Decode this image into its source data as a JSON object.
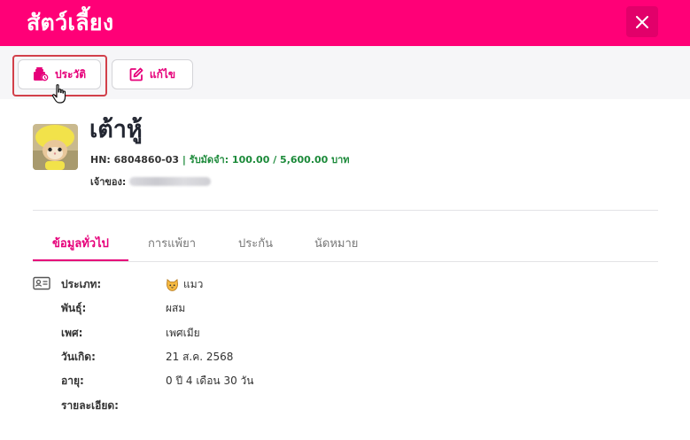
{
  "header": {
    "title": "สัตว์เลี้ยง"
  },
  "toolbar": {
    "history_label": "ประวัติ",
    "edit_label": "แก้ไข"
  },
  "pet": {
    "name": "เต้าหู้",
    "hn": "HN: 6804860-03",
    "separator": " | ",
    "deposit": "รับมัดจำ: 100.00 / 5,600.00 บาท",
    "owner_label": "เจ้าของ:"
  },
  "tabs": [
    {
      "label": "ข้อมูลทั่วไป",
      "active": true
    },
    {
      "label": "การแพ้ยา",
      "active": false
    },
    {
      "label": "ประกัน",
      "active": false
    },
    {
      "label": "นัดหมาย",
      "active": false
    }
  ],
  "info": {
    "type_label": "ประเภท:",
    "type_value": "แมว",
    "breed_label": "พันธุ์:",
    "breed_value": "ผสม",
    "sex_label": "เพศ:",
    "sex_value": "เพศเมีย",
    "birth_label": "วันเกิด:",
    "birth_value": "21 ส.ค. 2568",
    "age_label": "อายุ:",
    "age_value": "0 ปี 4 เดือน 30 วัน",
    "detail_label": "รายละเอียด:"
  },
  "colors": {
    "accent": "#ff0077",
    "deposit_green": "#1c8a3a",
    "highlight": "#d2404a"
  },
  "icons": [
    "close-icon",
    "history-icon",
    "edit-icon",
    "cursor-hand-icon",
    "id-card-icon",
    "cat-emoji-icon"
  ]
}
